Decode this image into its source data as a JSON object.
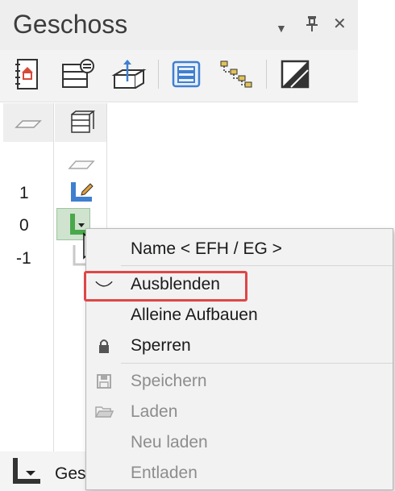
{
  "panel": {
    "title": "Geschoss",
    "controls": {
      "dropdown": "▼",
      "pin": "📌",
      "close": "✕"
    }
  },
  "toolbar": {
    "icons": [
      "story-manager-icon",
      "story-settings-icon",
      "story-height-icon",
      "story-list-icon",
      "story-tree-icon",
      "render-toggle-icon"
    ]
  },
  "levels": [
    "1",
    "0",
    "-1"
  ],
  "context_menu": {
    "items": [
      {
        "label": "Name < EFH / EG >",
        "icon": "",
        "enabled": true
      },
      {
        "label": "Ausblenden",
        "icon": "hide-eye-icon",
        "enabled": true,
        "highlighted": true
      },
      {
        "label": "Alleine Aufbauen",
        "icon": "",
        "enabled": true
      },
      {
        "label": "Sperren",
        "icon": "lock-icon",
        "enabled": true
      },
      {
        "label": "Speichern",
        "icon": "save-icon",
        "enabled": false
      },
      {
        "label": "Laden",
        "icon": "folder-icon",
        "enabled": false
      },
      {
        "label": "Neu laden",
        "icon": "",
        "enabled": false
      },
      {
        "label": "Entladen",
        "icon": "",
        "enabled": false
      }
    ]
  },
  "bottom_tab": {
    "label": "Ges"
  },
  "colors": {
    "highlight_border": "#e04646",
    "accent_blue": "#3f7fd0",
    "accent_green": "#4aa84a",
    "house_red": "#d64a3a"
  }
}
